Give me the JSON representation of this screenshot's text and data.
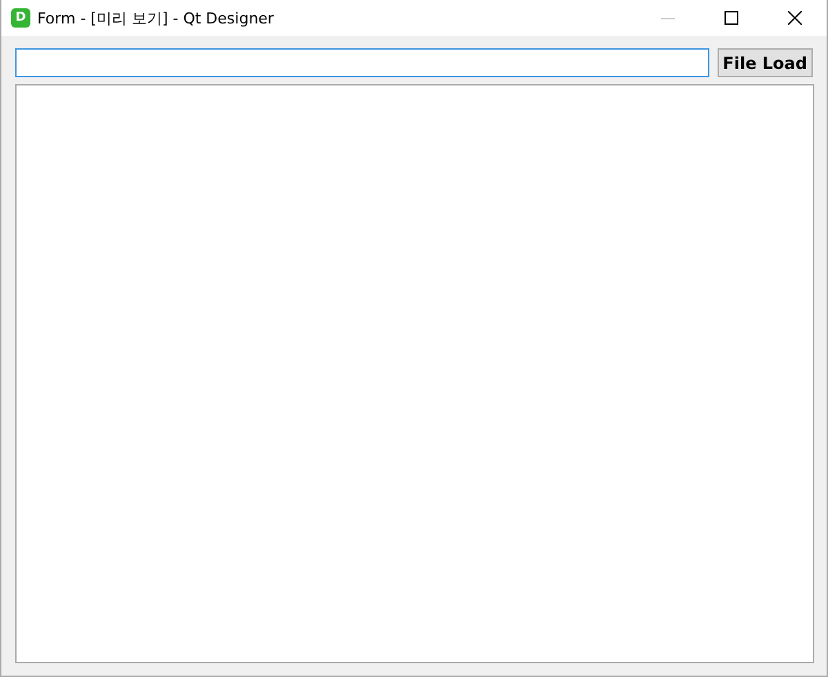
{
  "window": {
    "app_icon_letter": "D",
    "title": "Form - [미리 보기] - Qt Designer",
    "controls": [
      {
        "kind": "minimize",
        "disabled": true
      },
      {
        "kind": "maximize",
        "disabled": false
      },
      {
        "kind": "close",
        "disabled": false
      }
    ]
  },
  "path_field": {
    "focused": true
  },
  "load_button": {
    "label": "File Load"
  },
  "text_area": {
    "kind": "plain_text_edit"
  }
}
